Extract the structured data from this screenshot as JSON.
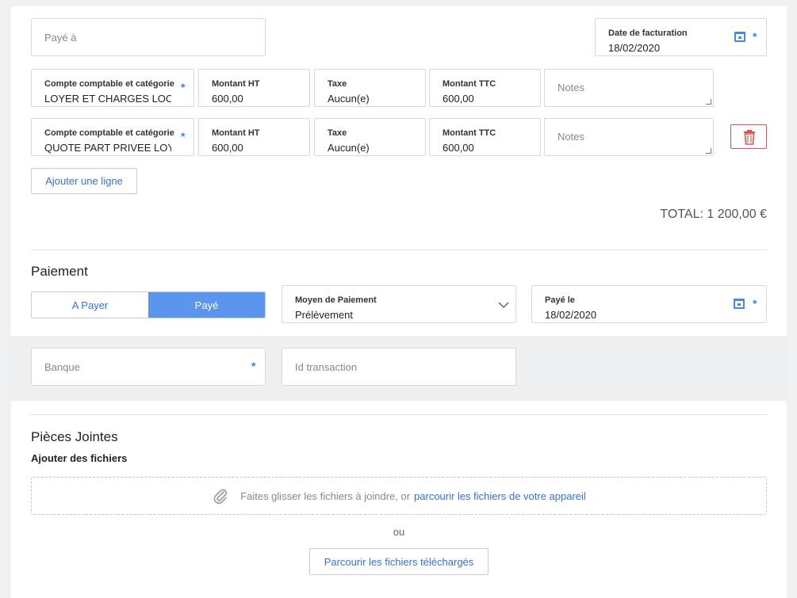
{
  "invoice": {
    "paye_a_placeholder": "Payé à",
    "date_facturation_label": "Date de facturation",
    "date_facturation_value": "18/02/2020"
  },
  "lines": [
    {
      "compte_label": "Compte comptable et catégorie",
      "compte_value": "LOYER ET CHARGES LOCAT",
      "ht_label": "Montant HT",
      "ht_value": "600,00",
      "taxe_label": "Taxe",
      "taxe_value": "Aucun(e)",
      "ttc_label": "Montant TTC",
      "ttc_value": "600,00",
      "notes_placeholder": "Notes"
    },
    {
      "compte_label": "Compte comptable et catégorie",
      "compte_value": "QUOTE PART PRIVEE LOYEF",
      "ht_label": "Montant HT",
      "ht_value": "600,00",
      "taxe_label": "Taxe",
      "taxe_value": "Aucun(e)",
      "ttc_label": "Montant TTC",
      "ttc_value": "600,00",
      "notes_placeholder": "Notes"
    }
  ],
  "add_line_label": "Ajouter une ligne",
  "total_text": "TOTAL: 1 200,00 €",
  "payment": {
    "title": "Paiement",
    "a_payer_label": "A Payer",
    "paye_label": "Payé",
    "moyen_label": "Moyen de Paiement",
    "moyen_value": "Prélèvement",
    "paye_le_label": "Payé le",
    "paye_le_value": "18/02/2020",
    "banque_placeholder": "Banque",
    "transaction_placeholder": "Id transaction"
  },
  "attachments": {
    "title": "Pièces Jointes",
    "subtitle": "Ajouter des fichiers",
    "drop_text": "Faites glisser les fichiers à joindre, or",
    "drop_link": "parcourir les fichiers de votre appareil",
    "ou": "ou",
    "browse_uploaded": "Parcourir les fichiers téléchargés"
  },
  "colors": {
    "accent": "#3f7ff0",
    "toggle_active": "#5b95f0",
    "delete_border": "#d9534f"
  },
  "icons": [
    "calendar-icon",
    "trash-icon",
    "chevron-down-icon",
    "paperclip-icon"
  ]
}
